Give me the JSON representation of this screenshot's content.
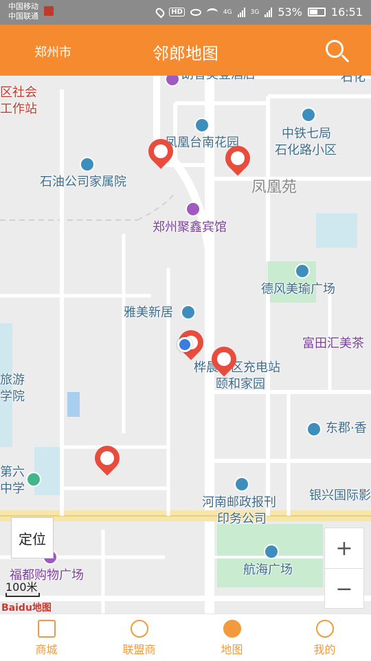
{
  "statusbar": {
    "carrier1": "中国移动",
    "carrier2": "中国联通",
    "network1": "4G",
    "network2": "3G",
    "battery": "53%",
    "time": "16:51"
  },
  "header": {
    "city": "郑州市",
    "title": "邻郎地图",
    "search_icon": "search-icon"
  },
  "map": {
    "labels": {
      "hotel_top": "朗香美登酒店",
      "shihua": "石化",
      "community_work_1": "区社会",
      "community_work_2": "工作站",
      "fenghuangtai": "凤凰台南花园",
      "zhongtie_1": "中铁七局",
      "zhongtie_2": "石化路小区",
      "shiyou": "石油公司家属院",
      "fenghuangyuan": "凤凰苑",
      "juxin": "郑州聚鑫宾馆",
      "defeng": "德风美瑜广场",
      "yamei": "雅美新居",
      "futian": "富田汇美茶",
      "charging": "桦晨小区充电站",
      "yihe": "颐和家园",
      "lvyou_1": "旅游",
      "lvyou_2": "学院",
      "dongjun": "东郡·香",
      "diliu_1": "第六",
      "diliu_2": "中学",
      "post_1": "河南邮政报刊",
      "post_2": "印务公司",
      "yinxing": "银兴国际影",
      "fudu": "福都购物广场",
      "hanghai": "航海广场"
    },
    "locate_button": "定位",
    "zoom_in": "+",
    "zoom_out": "−",
    "scale": "100米",
    "baidu_logo": "Baidu地图"
  },
  "tabs": [
    {
      "label": "商城",
      "icon": "home-icon"
    },
    {
      "label": "联盟商",
      "icon": "planet-icon"
    },
    {
      "label": "地图",
      "icon": "map-icon",
      "active": true
    },
    {
      "label": "我的",
      "icon": "user-icon"
    }
  ],
  "colors": {
    "header": "#f58a2e",
    "tab_accent": "#f29a3c",
    "marker": "#e74c3c",
    "location_dot": "#3c7be0"
  }
}
